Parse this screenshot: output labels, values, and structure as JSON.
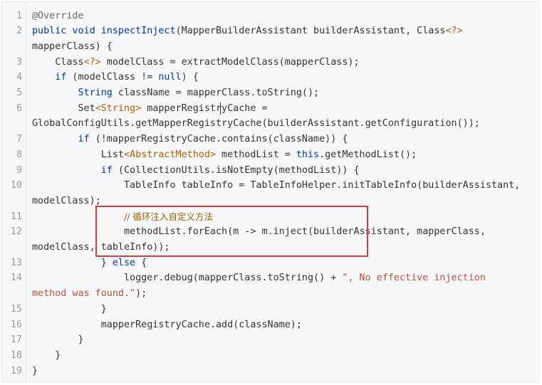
{
  "code_block": {
    "highlight_color": "#d93a3a",
    "lines": [
      {
        "n": "1",
        "segs": [
          {
            "t": "@Override",
            "c": "ann"
          }
        ]
      },
      {
        "n": "2",
        "segs": [
          {
            "t": "public void ",
            "c": "kw"
          },
          {
            "t": "inspectInject",
            "c": "fn"
          },
          {
            "t": "(MapperBuilderAssistant builderAssistant, Class"
          },
          {
            "t": "<?>",
            "c": "gen"
          }
        ]
      },
      {
        "n": "",
        "segs": [
          {
            "t": "mapperClass) {"
          }
        ]
      },
      {
        "n": "3",
        "segs": [
          {
            "t": "    Class"
          },
          {
            "t": "<?>",
            "c": "gen"
          },
          {
            "t": " modelClass = extractModelClass(mapperClass);"
          }
        ]
      },
      {
        "n": "4",
        "segs": [
          {
            "t": "    "
          },
          {
            "t": "if",
            "c": "kw"
          },
          {
            "t": " (modelClass != "
          },
          {
            "t": "null",
            "c": "kw"
          },
          {
            "t": ") {"
          }
        ]
      },
      {
        "n": "5",
        "segs": [
          {
            "t": "        "
          },
          {
            "t": "String",
            "c": "kw"
          },
          {
            "t": " className = mapperClass.toString();"
          }
        ]
      },
      {
        "n": "6",
        "segs": [
          {
            "t": "        Set"
          },
          {
            "t": "<String>",
            "c": "gen"
          },
          {
            "t": " mapperRegistryCache ="
          }
        ]
      },
      {
        "n": "",
        "segs": [
          {
            "t": "GlobalConfigUtils.getMapperRegistryCache(builderAssistant.getConfiguration());"
          }
        ]
      },
      {
        "n": "7",
        "segs": [
          {
            "t": "        "
          },
          {
            "t": "if",
            "c": "kw"
          },
          {
            "t": " (!mapperRegistryCache.contains(className)) {"
          }
        ]
      },
      {
        "n": "8",
        "segs": [
          {
            "t": "            List"
          },
          {
            "t": "<AbstractMethod>",
            "c": "gen"
          },
          {
            "t": " methodList = "
          },
          {
            "t": "this",
            "c": "kw"
          },
          {
            "t": ".getMethodList();"
          }
        ]
      },
      {
        "n": "9",
        "segs": [
          {
            "t": "            "
          },
          {
            "t": "if",
            "c": "kw"
          },
          {
            "t": " (CollectionUtils.isNotEmpty(methodList)) {"
          }
        ]
      },
      {
        "n": "10",
        "segs": [
          {
            "t": "                TableInfo tableInfo = TableInfoHelper.initTableInfo(builderAssistant,"
          }
        ]
      },
      {
        "n": "",
        "segs": [
          {
            "t": "modelClass);"
          }
        ]
      },
      {
        "n": "11",
        "segs": [
          {
            "t": "                "
          },
          {
            "t": "// 循环注入自定义方法",
            "c": "cmt"
          }
        ]
      },
      {
        "n": "12",
        "segs": [
          {
            "t": "                methodList.forEach(m -> m.inject(builderAssistant, mapperClass,"
          }
        ]
      },
      {
        "n": "",
        "segs": [
          {
            "t": "modelClass, tableInfo));"
          }
        ]
      },
      {
        "n": "13",
        "segs": [
          {
            "t": "            } "
          },
          {
            "t": "else",
            "c": "kw"
          },
          {
            "t": " {"
          }
        ]
      },
      {
        "n": "14",
        "segs": [
          {
            "t": "                logger.debug(mapperClass.toString() + "
          },
          {
            "t": "\", No effective injection",
            "c": "str"
          }
        ]
      },
      {
        "n": "",
        "segs": [
          {
            "t": "method was found.\"",
            "c": "str"
          },
          {
            "t": ");"
          }
        ]
      },
      {
        "n": "15",
        "segs": [
          {
            "t": "            }"
          }
        ]
      },
      {
        "n": "16",
        "segs": [
          {
            "t": "            mapperRegistryCache.add(className);"
          }
        ]
      },
      {
        "n": "17",
        "segs": [
          {
            "t": "        }"
          }
        ]
      },
      {
        "n": "18",
        "segs": [
          {
            "t": "    }"
          }
        ]
      },
      {
        "n": "19",
        "segs": [
          {
            "t": "}"
          }
        ]
      }
    ]
  }
}
